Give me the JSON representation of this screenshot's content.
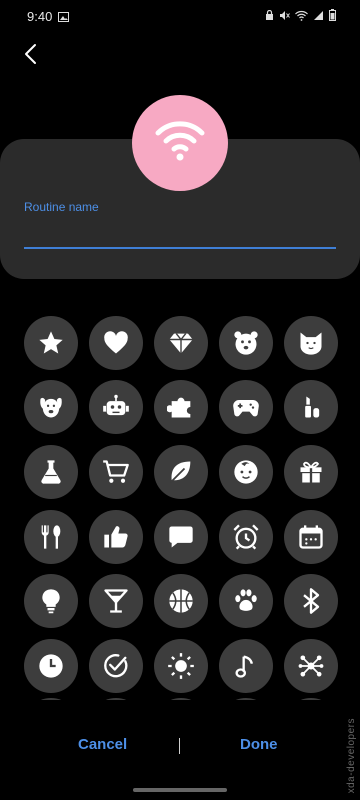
{
  "status_bar": {
    "time": "9:40"
  },
  "routine_name_label": "Routine name",
  "routine_name_value": "",
  "selected_icon": "wifi-icon",
  "icon_color": "#f7a9c3",
  "icons": [
    "star",
    "heart",
    "diamond",
    "bear",
    "cat",
    "dog",
    "robot",
    "puzzle",
    "gamepad",
    "lipstick",
    "flask",
    "cart",
    "leaf",
    "baby",
    "gift",
    "utensils",
    "thumbs-up",
    "speech-bubble",
    "alarm-clock",
    "calendar",
    "bulb",
    "cocktail",
    "basketball",
    "paw",
    "bluetooth",
    "clock",
    "check-circle",
    "sun",
    "music-note",
    "network"
  ],
  "footer": {
    "cancel": "Cancel",
    "done": "Done"
  },
  "watermark": "xda-developers"
}
